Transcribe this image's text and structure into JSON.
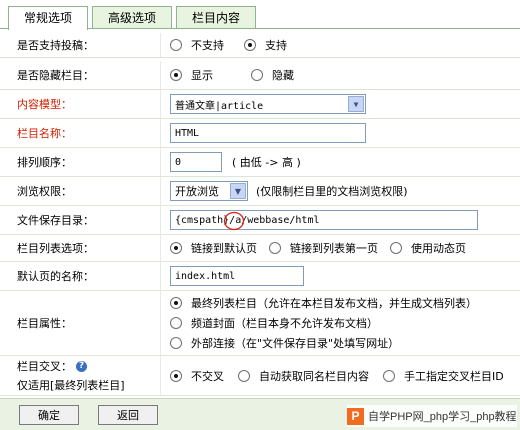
{
  "tabs": [
    {
      "label": "常规选项"
    },
    {
      "label": "高级选项"
    },
    {
      "label": "栏目内容"
    }
  ],
  "rows": {
    "allow_submit": {
      "label": "是否支持投稿：",
      "options": [
        "不支持",
        "支持"
      ],
      "selected": "支持"
    },
    "hidden": {
      "label": "是否隐藏栏目：",
      "options": [
        "显示",
        "隐藏"
      ],
      "selected": "显示"
    },
    "content_model": {
      "label": "内容模型：",
      "value": "普通文章|article"
    },
    "column_name": {
      "label": "栏目名称：",
      "value": "HTML"
    },
    "sort_order": {
      "label": "排列顺序：",
      "value": "0",
      "hint": "( 由低 -> 高 )"
    },
    "browse_permission": {
      "label": "浏览权限：",
      "value": "开放浏览",
      "hint": "(仅限制栏目里的文档浏览权限)"
    },
    "save_dir": {
      "label": "文件保存目录：",
      "value": "{cmspath}/a/webbase/html"
    },
    "list_options": {
      "label": "栏目列表选项：",
      "options": [
        "链接到默认页",
        "链接到列表第一页",
        "使用动态页"
      ],
      "selected": "链接到默认页"
    },
    "default_page": {
      "label": "默认页的名称：",
      "value": "index.html"
    },
    "attribute": {
      "label": "栏目属性：",
      "options": [
        "最终列表栏目（允许在本栏目发布文档，并生成文档列表）",
        "频道封面（栏目本身不允许发布文档）",
        "外部连接（在\"文件保存目录\"处填写网址）"
      ],
      "selected": "最终列表栏目（允许在本栏目发布文档，并生成文档列表）"
    },
    "cross": {
      "label": "栏目交叉：",
      "sublabel": "仅适用[最终列表栏目]",
      "help_icon": "?",
      "options": [
        "不交叉",
        "自动获取同名栏目内容",
        "手工指定交叉栏目ID"
      ],
      "selected": "不交叉"
    }
  },
  "buttons": {
    "ok": "确定",
    "back": "返回"
  },
  "watermark": {
    "logo": "P",
    "text": "自学PHP网_php学习_php教程"
  },
  "colors": {
    "red_label": "#d02000",
    "tab_bg": "#e8f3e0",
    "footer_bg": "#eaf3e3",
    "annotation": "#e0201a"
  }
}
